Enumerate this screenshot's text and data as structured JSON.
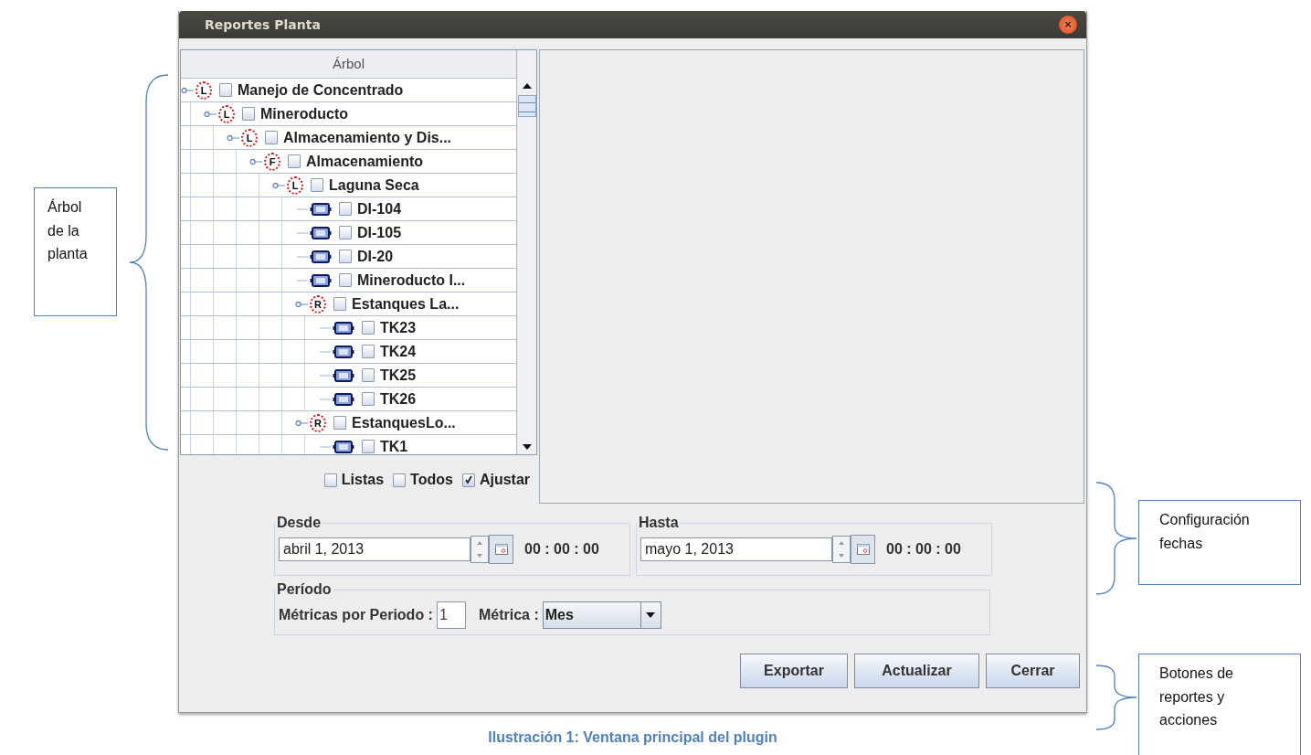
{
  "left_note": {
    "lines": [
      "Árbol",
      "de la",
      "planta"
    ]
  },
  "right_notes": [
    {
      "lines": [
        "Configuración",
        "fechas"
      ]
    },
    {
      "lines": [
        "Botones de",
        "reportes y",
        "acciones"
      ]
    }
  ],
  "window": {
    "title": "Reportes Planta",
    "close": "×"
  },
  "tree": {
    "header": "Árbol",
    "nodes": [
      {
        "kind": "group",
        "badge": "L",
        "label": "Manejo de Concentrado",
        "checked": false,
        "children": [
          {
            "kind": "group",
            "badge": "L",
            "label": "Mineroducto",
            "checked": false,
            "children": [
              {
                "kind": "group",
                "badge": "L",
                "label": "Almacenamiento y Dis...",
                "checked": false,
                "children": [
                  {
                    "kind": "group",
                    "badge": "F",
                    "label": "Almacenamiento",
                    "checked": false,
                    "children": [
                      {
                        "kind": "group",
                        "badge": "L",
                        "label": "Laguna Seca",
                        "checked": false,
                        "children": [
                          {
                            "kind": "device",
                            "label": "DI-104",
                            "checked": false
                          },
                          {
                            "kind": "device",
                            "label": "DI-105",
                            "checked": false
                          },
                          {
                            "kind": "device",
                            "label": "DI-20",
                            "checked": false
                          },
                          {
                            "kind": "device",
                            "label": "Mineroducto I...",
                            "checked": false
                          },
                          {
                            "kind": "group",
                            "badge": "R",
                            "label": "Estanques La...",
                            "checked": false,
                            "children": [
                              {
                                "kind": "device",
                                "label": "TK23",
                                "checked": false
                              },
                              {
                                "kind": "device",
                                "label": "TK24",
                                "checked": false
                              },
                              {
                                "kind": "device",
                                "label": "TK25",
                                "checked": false
                              },
                              {
                                "kind": "device",
                                "label": "TK26",
                                "checked": false
                              }
                            ]
                          },
                          {
                            "kind": "group",
                            "badge": "R",
                            "label": "EstanquesLo...",
                            "checked": false,
                            "children": [
                              {
                                "kind": "device",
                                "label": "TK1",
                                "checked": false
                              }
                            ]
                          }
                        ]
                      }
                    ]
                  }
                ]
              }
            ]
          }
        ]
      }
    ]
  },
  "options": [
    {
      "label": "Listas",
      "checked": false
    },
    {
      "label": "Todos",
      "checked": false
    },
    {
      "label": "Ajustar",
      "checked": true
    }
  ],
  "desde": {
    "legend": "Desde",
    "date": "abril 1, 2013",
    "time": "00 : 00 : 00"
  },
  "hasta": {
    "legend": "Hasta",
    "date": "mayo 1, 2013",
    "time": "00 : 00 : 00"
  },
  "periodo": {
    "legend": "Período",
    "metrics_label": "Métricas por Periodo :",
    "metrics_value": "1",
    "metric_label": "Métrica :",
    "metric_value": "Mes"
  },
  "buttons": [
    "Exportar",
    "Actualizar",
    "Cerrar"
  ],
  "caption": "Ilustración 1: Ventana principal del plugin"
}
